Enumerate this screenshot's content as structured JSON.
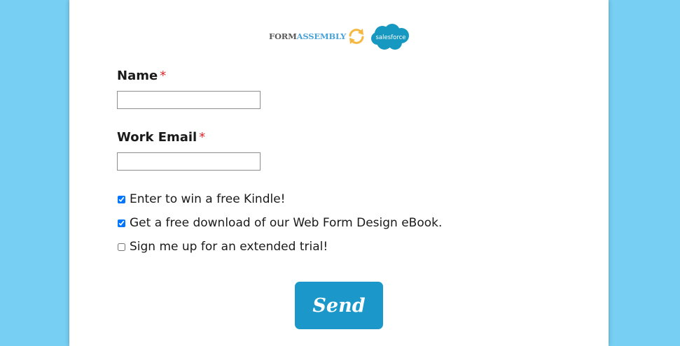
{
  "logos": {
    "formassembly_word1": "FORM",
    "formassembly_word2": "ASSEMBLY",
    "sync_icon": "sync-arrows-icon",
    "salesforce_text": "salesforce"
  },
  "form": {
    "name_label": "Name",
    "name_required_mark": "*",
    "name_value": "",
    "email_label": "Work Email",
    "email_required_mark": "*",
    "email_value": "",
    "checkboxes": [
      {
        "label": "Enter to win a free Kindle!",
        "checked": true
      },
      {
        "label": "Get a free download of our Web Form Design eBook.",
        "checked": true
      },
      {
        "label": "Sign me up for an extended trial!",
        "checked": false
      }
    ],
    "submit_label": "Send"
  },
  "colors": {
    "background": "#77cff3",
    "button": "#1b98c9",
    "required": "#e0262a",
    "sync_icon": "#f5b942",
    "salesforce_cloud": "#1798c1"
  }
}
